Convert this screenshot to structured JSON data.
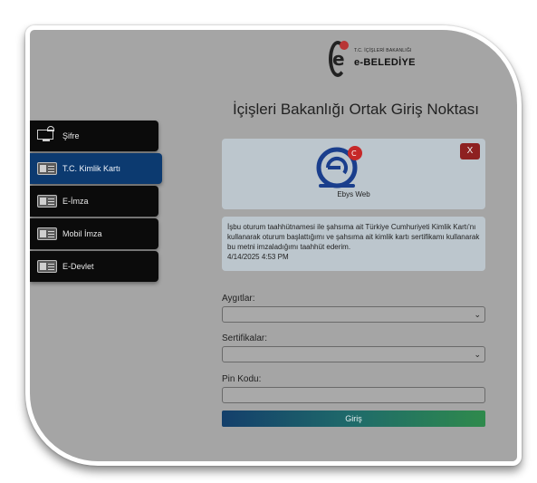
{
  "logo": {
    "small_text": "T.C. İÇİŞLERİ BAKANLIĞI",
    "big_text": "e-BELEDİYE"
  },
  "title": "İçişleri Bakanlığı Ortak Giriş Noktası",
  "menu": {
    "items": [
      {
        "label": "Şifre",
        "icon": "lock-computer-icon",
        "active": false
      },
      {
        "label": "T.C. Kimlik Kartı",
        "icon": "id-card-icon",
        "active": true
      },
      {
        "label": "E-İmza",
        "icon": "id-card-icon",
        "active": false
      },
      {
        "label": "Mobil İmza",
        "icon": "id-card-icon",
        "active": false
      },
      {
        "label": "E-Devlet",
        "icon": "id-card-icon",
        "active": false
      }
    ]
  },
  "card": {
    "app_name": "Ebys Web",
    "close_label": "X"
  },
  "notice": {
    "text": "İşbu oturum taahhütnamesi ile şahsıma ait Türkiye Cumhuriyeti Kimlik Kartı'nı kullanarak oturum başlattığımı ve şahsıma ait kimlik kartı sertifikamı kullanarak bu metni imzaladığımı taahhüt ederim.",
    "timestamp": "4/14/2025 4:53 PM"
  },
  "form": {
    "devices_label": "Aygıtlar:",
    "devices_value": "",
    "certs_label": "Sertifikalar:",
    "certs_value": "",
    "pin_label": "Pin Kodu:",
    "pin_value": "",
    "submit_label": "Giriş"
  },
  "colors": {
    "overlay": "#a5a5a5",
    "menu_bg": "#0b0b0b",
    "menu_active": "#0c3a70",
    "close_btn": "#8e2121",
    "brand_blue": "#1a3e8c",
    "brand_red": "#c62828"
  }
}
